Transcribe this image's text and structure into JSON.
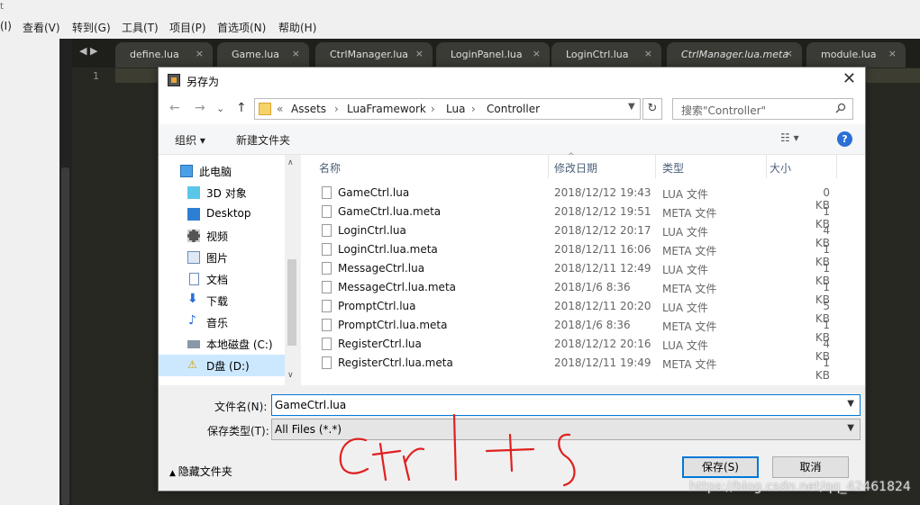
{
  "editor": {
    "title_fragment": "t",
    "menu": [
      "(I)",
      "查看(V)",
      "转到(G)",
      "工具(T)",
      "项目(P)",
      "首选项(N)",
      "帮助(H)"
    ],
    "tabs": [
      "define.lua",
      "Game.lua",
      "CtrlManager.lua",
      "LoginPanel.lua",
      "LoginCtrl.lua",
      "CtrlManager.lua.meta",
      "module.lua"
    ],
    "line_number": "1"
  },
  "dialog": {
    "title": "另存为",
    "breadcrumb": [
      "«",
      "Assets",
      "›",
      "LuaFramework",
      "›",
      "Lua",
      "›",
      "Controller"
    ],
    "search_placeholder": "搜索\"Controller\"",
    "toolbar": {
      "organize": "组织 ▾",
      "new_folder": "新建文件夹"
    },
    "nav": [
      {
        "label": "此电脑",
        "icon": "computer-icon"
      },
      {
        "label": "3D 对象",
        "icon": "3d-objects-icon"
      },
      {
        "label": "Desktop",
        "icon": "desktop-icon"
      },
      {
        "label": "视频",
        "icon": "video-icon"
      },
      {
        "label": "图片",
        "icon": "pictures-icon"
      },
      {
        "label": "文档",
        "icon": "documents-icon"
      },
      {
        "label": "下载",
        "icon": "download-icon"
      },
      {
        "label": "音乐",
        "icon": "music-icon"
      },
      {
        "label": "本地磁盘 (C:)",
        "icon": "drive-icon"
      },
      {
        "label": "D盘 (D:)",
        "icon": "drive-warning-icon"
      }
    ],
    "columns": {
      "name": "名称",
      "date": "修改日期",
      "type": "类型",
      "size": "大小"
    },
    "files": [
      {
        "name": "GameCtrl.lua",
        "date": "2018/12/12 19:43",
        "type": "LUA 文件",
        "size": "0 KB"
      },
      {
        "name": "GameCtrl.lua.meta",
        "date": "2018/12/12 19:51",
        "type": "META 文件",
        "size": "1 KB"
      },
      {
        "name": "LoginCtrl.lua",
        "date": "2018/12/12 20:17",
        "type": "LUA 文件",
        "size": "4 KB"
      },
      {
        "name": "LoginCtrl.lua.meta",
        "date": "2018/12/11 16:06",
        "type": "META 文件",
        "size": "1 KB"
      },
      {
        "name": "MessageCtrl.lua",
        "date": "2018/12/11 12:49",
        "type": "LUA 文件",
        "size": "1 KB"
      },
      {
        "name": "MessageCtrl.lua.meta",
        "date": "2018/1/6 8:36",
        "type": "META 文件",
        "size": "1 KB"
      },
      {
        "name": "PromptCtrl.lua",
        "date": "2018/12/11 20:20",
        "type": "LUA 文件",
        "size": "5 KB"
      },
      {
        "name": "PromptCtrl.lua.meta",
        "date": "2018/1/6 8:36",
        "type": "META 文件",
        "size": "1 KB"
      },
      {
        "name": "RegisterCtrl.lua",
        "date": "2018/12/12 20:16",
        "type": "LUA 文件",
        "size": "4 KB"
      },
      {
        "name": "RegisterCtrl.lua.meta",
        "date": "2018/12/11 19:49",
        "type": "META 文件",
        "size": "1 KB"
      }
    ],
    "filename_label": "文件名(N):",
    "filename_value": "GameCtrl.lua",
    "filetype_label": "保存类型(T):",
    "filetype_value": "All Files (*.*)",
    "hide_folders": "隐藏文件夹",
    "save_button": "保存(S)",
    "cancel_button": "取消"
  },
  "annotation": {
    "handwriting": "Ctrl+S",
    "watermark": "https://blog.csdn.net/qq_42461824"
  },
  "colors": {
    "editor_bg": "#272822",
    "accent": "#0078d7",
    "selection": "#cce8ff",
    "ink": "#e02020"
  }
}
